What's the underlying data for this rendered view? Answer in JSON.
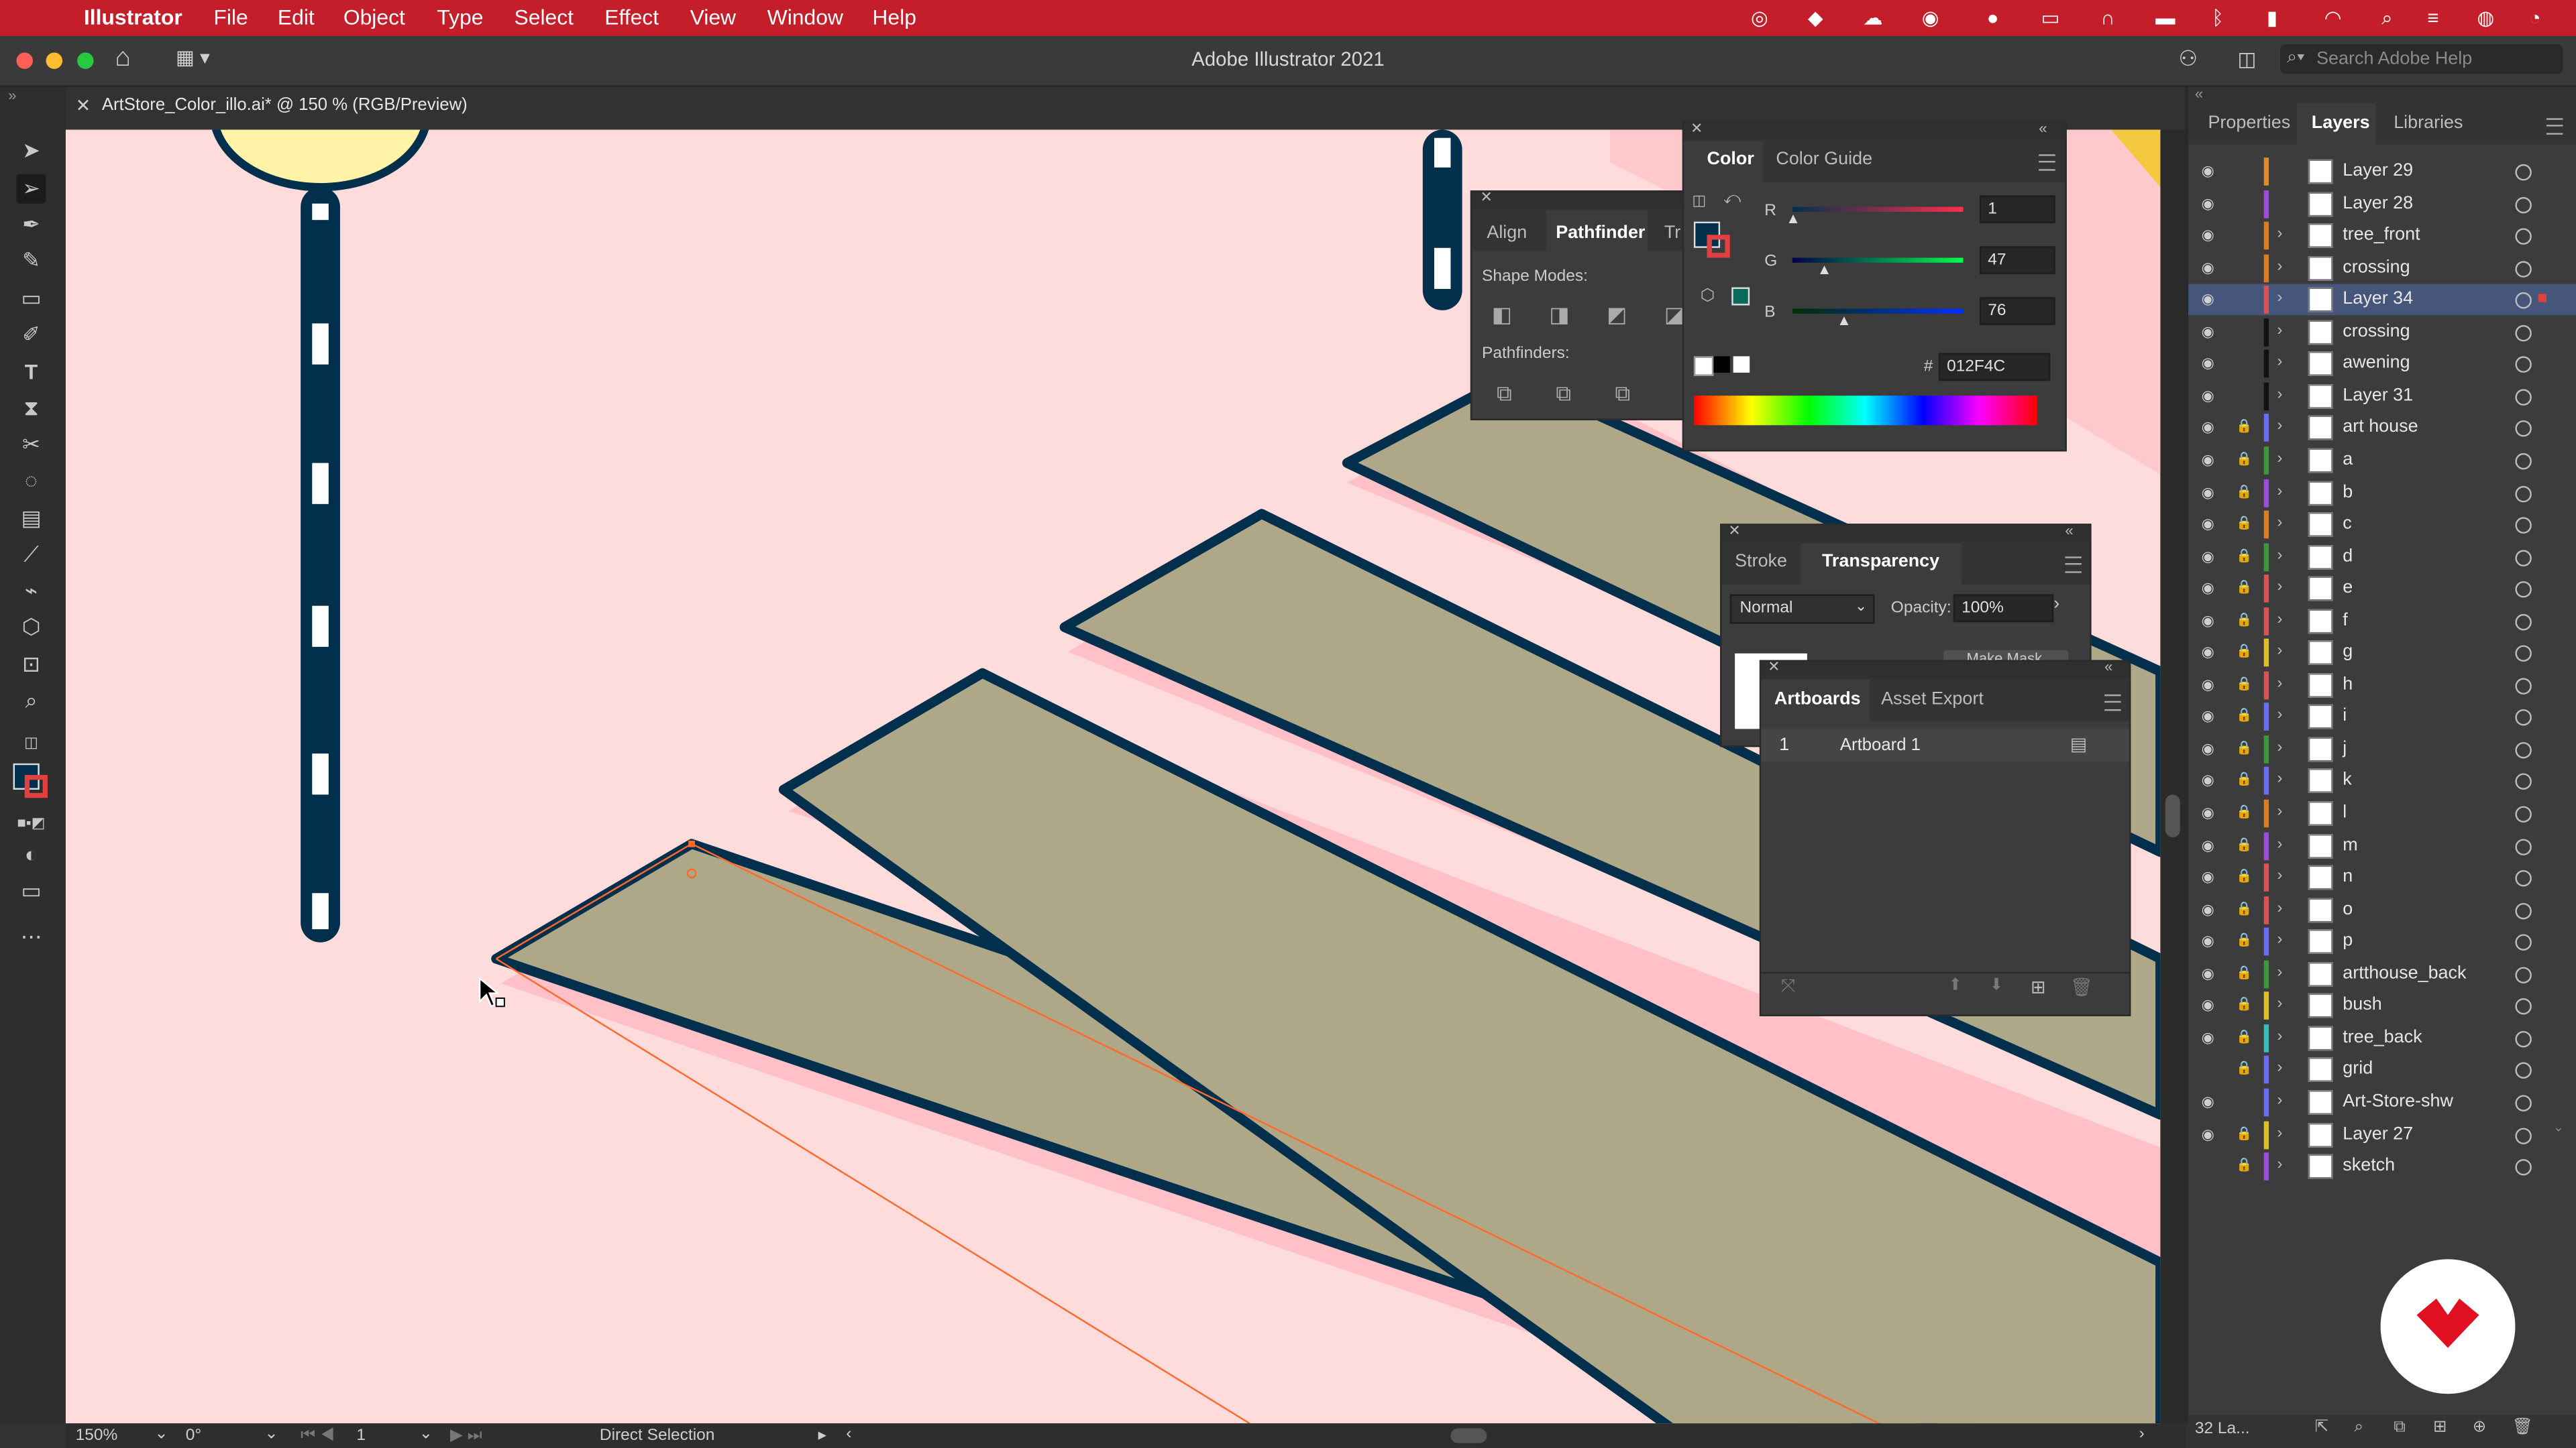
{
  "menubar": {
    "app_name": "Illustrator",
    "items": [
      "File",
      "Edit",
      "Object",
      "Type",
      "Select",
      "Effect",
      "View",
      "Window",
      "Help"
    ]
  },
  "window": {
    "title": "Adobe Illustrator 2021",
    "search_placeholder": "Search Adobe Help"
  },
  "doc_tab": {
    "label": "ArtStore_Color_illo.ai* @ 150 % (RGB/Preview)"
  },
  "pathfinder_panel": {
    "tabs": [
      "Align",
      "Pathfinder",
      "Tr"
    ],
    "shape_modes_label": "Shape Modes:",
    "pathfinders_label": "Pathfinders:"
  },
  "color_panel": {
    "tabs": [
      "Color",
      "Color Guide"
    ],
    "r_label": "R",
    "r_value": "1",
    "g_label": "G",
    "g_value": "47",
    "b_label": "B",
    "b_value": "76",
    "hex_symbol": "#",
    "hex_value": "012F4C",
    "fill_color": "#012F4C"
  },
  "transparency_panel": {
    "tabs": [
      "Stroke",
      "Transparency"
    ],
    "blend_mode": "Normal",
    "opacity_label": "Opacity:",
    "opacity_value": "100%",
    "make_mask": "Make Mask"
  },
  "artboards_panel": {
    "tabs": [
      "Artboards",
      "Asset Export"
    ],
    "rows": [
      {
        "num": "1",
        "name": "Artboard 1"
      }
    ]
  },
  "right_panel": {
    "tabs": [
      "Properties",
      "Layers",
      "Libraries"
    ],
    "footer_count": "32 La..."
  },
  "layers": [
    {
      "name": "Layer 29",
      "color": "#e58a20",
      "locked": false,
      "visible": true,
      "expandable": false
    },
    {
      "name": "Layer 28",
      "color": "#9b4de0",
      "locked": false,
      "visible": true,
      "expandable": false
    },
    {
      "name": "tree_front",
      "color": "#e07a20",
      "locked": false,
      "visible": true,
      "expandable": true
    },
    {
      "name": "crossing",
      "color": "#e07a20",
      "locked": false,
      "visible": true,
      "expandable": true
    },
    {
      "name": "Layer 34",
      "color": "#e05050",
      "locked": false,
      "visible": true,
      "expandable": true,
      "selected": true
    },
    {
      "name": "crossing",
      "color": "#111111",
      "locked": false,
      "visible": true,
      "expandable": true
    },
    {
      "name": "awening",
      "color": "#111111",
      "locked": false,
      "visible": true,
      "expandable": true
    },
    {
      "name": "Layer 31",
      "color": "#111111",
      "locked": false,
      "visible": true,
      "expandable": true
    },
    {
      "name": "art house",
      "color": "#6a6aff",
      "locked": true,
      "visible": true,
      "expandable": true
    },
    {
      "name": "a",
      "color": "#3a9a3a",
      "locked": true,
      "visible": true,
      "expandable": true
    },
    {
      "name": "b",
      "color": "#9b4de0",
      "locked": true,
      "visible": true,
      "expandable": true
    },
    {
      "name": "c",
      "color": "#e07a20",
      "locked": true,
      "visible": true,
      "expandable": true
    },
    {
      "name": "d",
      "color": "#3a9a3a",
      "locked": true,
      "visible": true,
      "expandable": true
    },
    {
      "name": "e",
      "color": "#e05050",
      "locked": true,
      "visible": true,
      "expandable": true
    },
    {
      "name": "f",
      "color": "#e05050",
      "locked": true,
      "visible": true,
      "expandable": true
    },
    {
      "name": "g",
      "color": "#e0c020",
      "locked": true,
      "visible": true,
      "expandable": true
    },
    {
      "name": "h",
      "color": "#e05050",
      "locked": true,
      "visible": true,
      "expandable": true
    },
    {
      "name": "i",
      "color": "#6a6aff",
      "locked": true,
      "visible": true,
      "expandable": true
    },
    {
      "name": "j",
      "color": "#3a9a3a",
      "locked": true,
      "visible": true,
      "expandable": true
    },
    {
      "name": "k",
      "color": "#6a6aff",
      "locked": true,
      "visible": true,
      "expandable": true
    },
    {
      "name": "l",
      "color": "#e07a20",
      "locked": true,
      "visible": true,
      "expandable": true
    },
    {
      "name": "m",
      "color": "#9b4de0",
      "locked": true,
      "visible": true,
      "expandable": true
    },
    {
      "name": "n",
      "color": "#e05050",
      "locked": true,
      "visible": true,
      "expandable": true
    },
    {
      "name": "o",
      "color": "#e05050",
      "locked": true,
      "visible": true,
      "expandable": true
    },
    {
      "name": "p",
      "color": "#6a6aff",
      "locked": true,
      "visible": true,
      "expandable": true
    },
    {
      "name": "artthouse_back",
      "color": "#3a9a3a",
      "locked": true,
      "visible": true,
      "expandable": true
    },
    {
      "name": "bush",
      "color": "#e0c020",
      "locked": true,
      "visible": true,
      "expandable": true
    },
    {
      "name": "tree_back",
      "color": "#30c0c0",
      "locked": true,
      "visible": true,
      "expandable": true
    },
    {
      "name": "grid",
      "color": "#6a6aff",
      "locked": true,
      "visible": false,
      "expandable": true
    },
    {
      "name": "Art-Store-shw",
      "color": "#6a6aff",
      "locked": false,
      "visible": true,
      "expandable": true
    },
    {
      "name": "Layer 27",
      "color": "#e0c020",
      "locked": true,
      "visible": true,
      "expandable": true
    },
    {
      "name": "sketch",
      "color": "#9b4de0",
      "locked": true,
      "visible": false,
      "expandable": true
    }
  ],
  "status_bar": {
    "zoom": "150%",
    "rotation": "0°",
    "artboard_num": "1",
    "tool_name": "Direct Selection"
  }
}
